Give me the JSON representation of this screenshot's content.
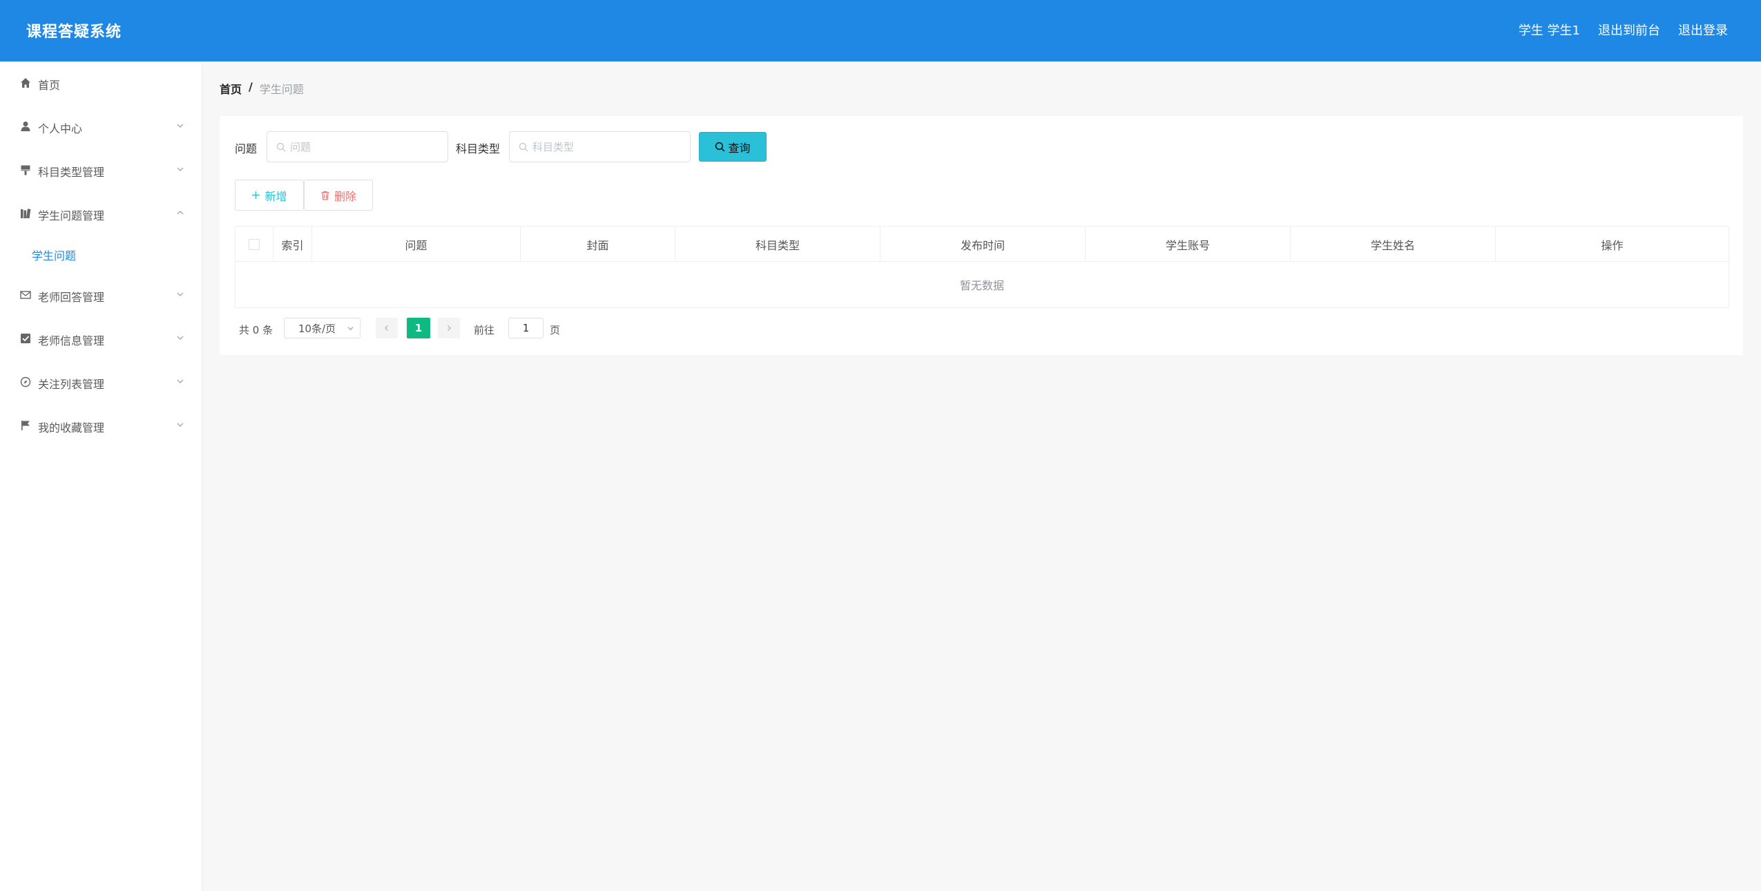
{
  "header": {
    "title": "课程答疑系统",
    "user_label": "学生 学生1",
    "back_label": "退出到前台",
    "logout_label": "退出登录"
  },
  "sidebar": {
    "items": [
      {
        "label": "首页",
        "icon": "home-icon"
      },
      {
        "label": "个人中心",
        "icon": "user-icon"
      },
      {
        "label": "科目类型管理",
        "icon": "brush-icon"
      },
      {
        "label": "学生问题管理",
        "icon": "books-icon"
      },
      {
        "label": "老师回答管理",
        "icon": "mail-icon"
      },
      {
        "label": "老师信息管理",
        "icon": "checkbox-icon"
      },
      {
        "label": "关注列表管理",
        "icon": "compass-icon"
      },
      {
        "label": "我的收藏管理",
        "icon": "flag-icon"
      }
    ],
    "submenu": {
      "label": "学生问题"
    }
  },
  "breadcrumb": {
    "home": "首页",
    "separator": "/",
    "current": "学生问题"
  },
  "search": {
    "question_label": "问题",
    "question_placeholder": "问题",
    "question_value": "",
    "subject_label": "科目类型",
    "subject_placeholder": "科目类型",
    "subject_value": "",
    "query_label": "查询"
  },
  "actions": {
    "add_label": "新增",
    "delete_label": "删除"
  },
  "table": {
    "columns": [
      "索引",
      "问题",
      "封面",
      "科目类型",
      "发布时间",
      "学生账号",
      "学生姓名",
      "操作"
    ],
    "empty_text": "暂无数据"
  },
  "pagination": {
    "total_text": "共 0 条",
    "page_size": "10条/页",
    "current_page": "1",
    "goto_label": "前往",
    "goto_value": "1",
    "page_suffix": "页"
  },
  "colors": {
    "header_bg": "#1f88e5",
    "accent": "#29c0d8",
    "active_page": "#10b981",
    "danger": "#f56c6c",
    "active_menu": "#1f88e5"
  }
}
